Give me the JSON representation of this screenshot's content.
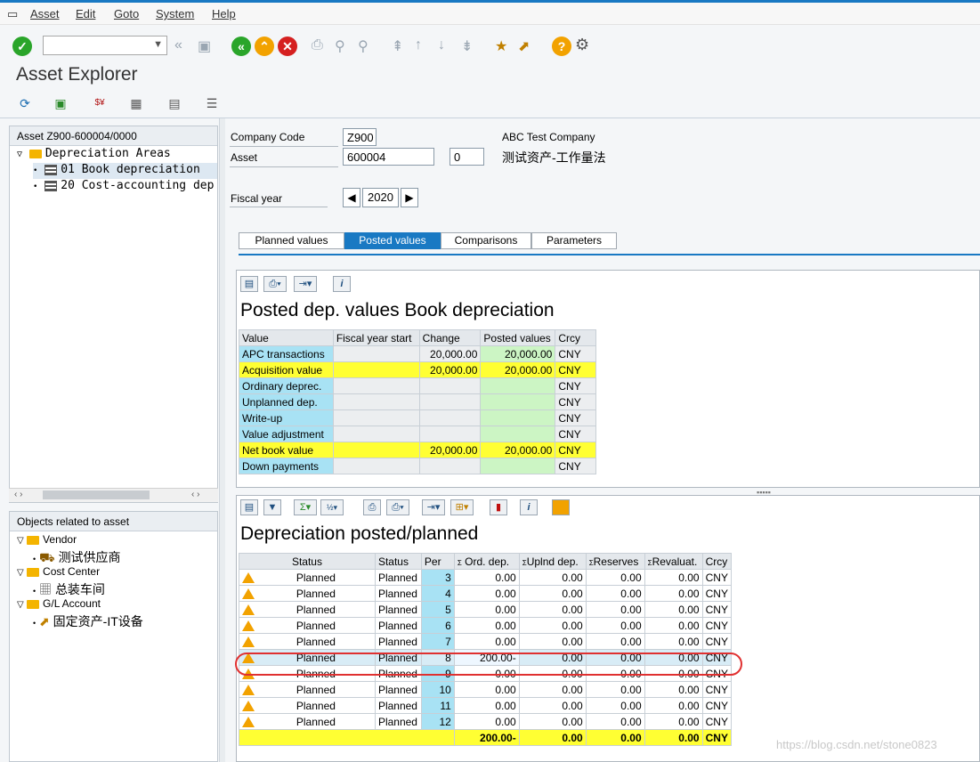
{
  "menu": {
    "items": [
      "Asset",
      "Edit",
      "Goto",
      "System",
      "Help"
    ]
  },
  "page_title": "Asset Explorer",
  "left_tree": {
    "header": "Asset Z900-600004/0000",
    "root": "Depreciation Areas",
    "items": [
      "01 Book depreciation",
      "20 Cost-accounting dep"
    ]
  },
  "objects": {
    "header": "Objects related to asset",
    "groups": [
      {
        "label": "Vendor",
        "child": "测试供应商"
      },
      {
        "label": "Cost Center",
        "child": "总装车间"
      },
      {
        "label": "G/L Account",
        "child": "固定资产-IT设备"
      }
    ]
  },
  "header_fields": {
    "company_code_label": "Company Code",
    "company_code": "Z900",
    "company_name": "ABC Test Company",
    "asset_label": "Asset",
    "asset_no": "600004",
    "asset_sub": "0",
    "asset_desc": "测试资产-工作量法",
    "fiscal_year_label": "Fiscal year",
    "fiscal_year": "2020"
  },
  "tabs": [
    {
      "label": "Planned values",
      "active": false
    },
    {
      "label": "Posted values",
      "active": true
    },
    {
      "label": "Comparisons",
      "active": false
    },
    {
      "label": "Parameters",
      "active": false
    }
  ],
  "posted": {
    "title": "Posted dep. values Book depreciation",
    "columns": [
      "Value",
      "Fiscal year start",
      "Change",
      "Posted values",
      "Crcy"
    ],
    "rows": [
      {
        "label": "APC transactions",
        "fys": "",
        "change": "20,000.00",
        "posted": "20,000.00",
        "crcy": "CNY",
        "style": "cyan"
      },
      {
        "label": "Acquisition value",
        "fys": "",
        "change": "20,000.00",
        "posted": "20,000.00",
        "crcy": "CNY",
        "style": "yellow"
      },
      {
        "label": "Ordinary deprec.",
        "fys": "",
        "change": "",
        "posted": "",
        "crcy": "CNY",
        "style": "cyan"
      },
      {
        "label": "Unplanned dep.",
        "fys": "",
        "change": "",
        "posted": "",
        "crcy": "CNY",
        "style": "cyan"
      },
      {
        "label": "Write-up",
        "fys": "",
        "change": "",
        "posted": "",
        "crcy": "CNY",
        "style": "cyan"
      },
      {
        "label": "Value adjustment",
        "fys": "",
        "change": "",
        "posted": "",
        "crcy": "CNY",
        "style": "cyan"
      },
      {
        "label": "Net book value",
        "fys": "",
        "change": "20,000.00",
        "posted": "20,000.00",
        "crcy": "CNY",
        "style": "yellow"
      },
      {
        "label": "Down payments",
        "fys": "",
        "change": "",
        "posted": "",
        "crcy": "CNY",
        "style": "cyan"
      }
    ]
  },
  "dep": {
    "title": "Depreciation posted/planned",
    "columns": [
      "Status",
      "Status",
      "Per",
      "Ord. dep.",
      "Uplnd dep.",
      "Reserves",
      "Revaluat.",
      "Crcy"
    ],
    "sigma": "Σ",
    "rows": [
      {
        "status": "Planned",
        "status2": "Planned",
        "per": "3",
        "ord": "0.00",
        "upl": "0.00",
        "res": "0.00",
        "rev": "0.00",
        "crcy": "CNY"
      },
      {
        "status": "Planned",
        "status2": "Planned",
        "per": "4",
        "ord": "0.00",
        "upl": "0.00",
        "res": "0.00",
        "rev": "0.00",
        "crcy": "CNY"
      },
      {
        "status": "Planned",
        "status2": "Planned",
        "per": "5",
        "ord": "0.00",
        "upl": "0.00",
        "res": "0.00",
        "rev": "0.00",
        "crcy": "CNY"
      },
      {
        "status": "Planned",
        "status2": "Planned",
        "per": "6",
        "ord": "0.00",
        "upl": "0.00",
        "res": "0.00",
        "rev": "0.00",
        "crcy": "CNY"
      },
      {
        "status": "Planned",
        "status2": "Planned",
        "per": "7",
        "ord": "0.00",
        "upl": "0.00",
        "res": "0.00",
        "rev": "0.00",
        "crcy": "CNY"
      },
      {
        "status": "Planned",
        "status2": "Planned",
        "per": "8",
        "ord": "200.00-",
        "upl": "0.00",
        "res": "0.00",
        "rev": "0.00",
        "crcy": "CNY"
      },
      {
        "status": "Planned",
        "status2": "Planned",
        "per": "9",
        "ord": "0.00",
        "upl": "0.00",
        "res": "0.00",
        "rev": "0.00",
        "crcy": "CNY"
      },
      {
        "status": "Planned",
        "status2": "Planned",
        "per": "10",
        "ord": "0.00",
        "upl": "0.00",
        "res": "0.00",
        "rev": "0.00",
        "crcy": "CNY"
      },
      {
        "status": "Planned",
        "status2": "Planned",
        "per": "11",
        "ord": "0.00",
        "upl": "0.00",
        "res": "0.00",
        "rev": "0.00",
        "crcy": "CNY"
      },
      {
        "status": "Planned",
        "status2": "Planned",
        "per": "12",
        "ord": "0.00",
        "upl": "0.00",
        "res": "0.00",
        "rev": "0.00",
        "crcy": "CNY"
      }
    ],
    "totals": {
      "ord": "200.00-",
      "upl": "0.00",
      "res": "0.00",
      "rev": "0.00",
      "crcy": "CNY"
    }
  },
  "watermark": "https://blog.csdn.net/stone0823"
}
